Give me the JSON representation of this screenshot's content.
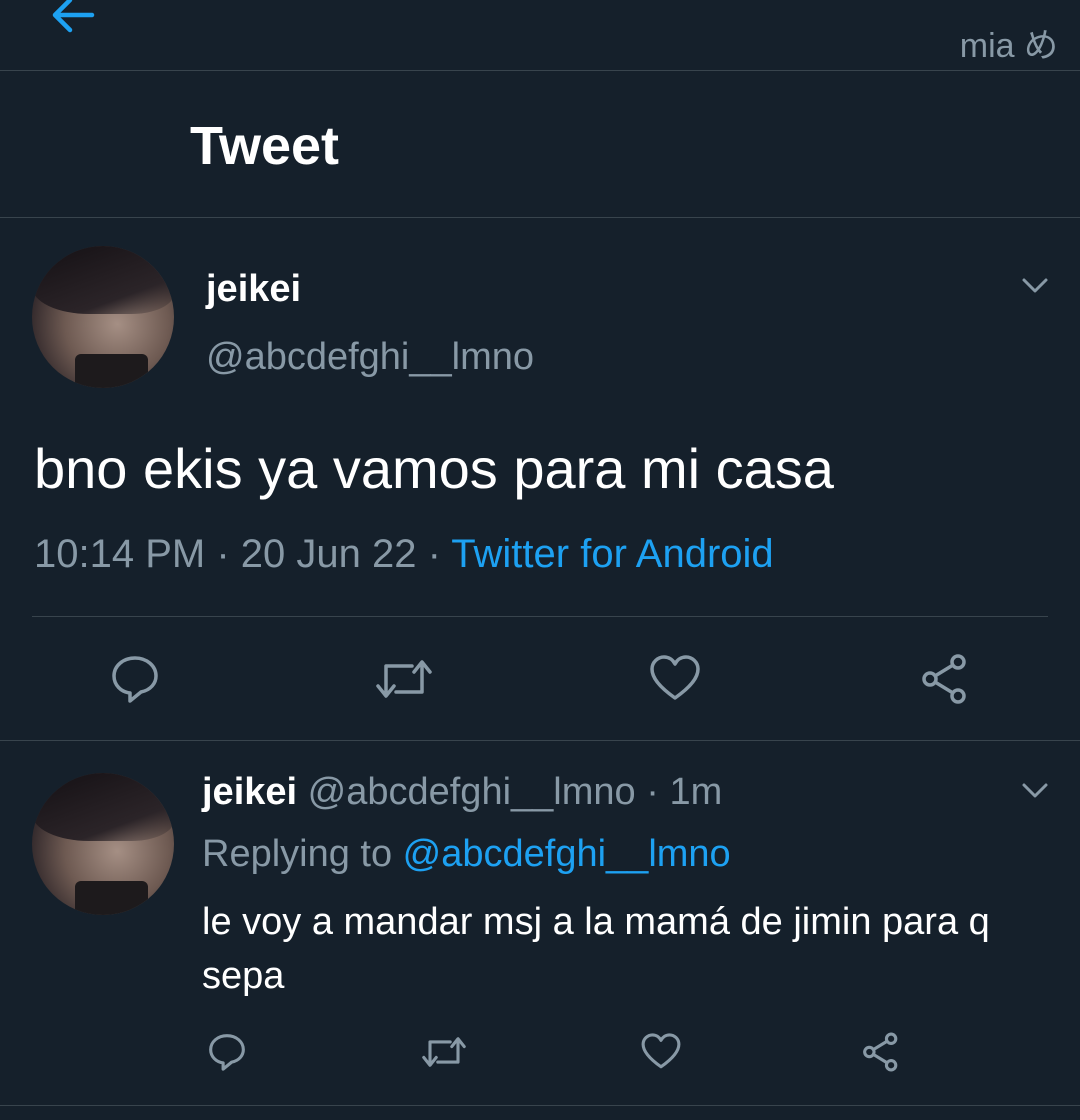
{
  "statusbar": {
    "tag": "mia め"
  },
  "header": {
    "title": "Tweet",
    "back_icon": "arrow-left-icon"
  },
  "colors": {
    "background": "#15202b",
    "accent": "#1da1f2",
    "muted": "#8899a6",
    "divider": "#38444d"
  },
  "main_tweet": {
    "display_name": "jeikei",
    "handle": "@abcdefghi__lmno",
    "text": "bno ekis ya vamos para mi casa",
    "time": "10:14 PM",
    "separator": " · ",
    "date": "20 Jun 22",
    "source": "Twitter for Android",
    "actions": [
      "reply-icon",
      "retweet-icon",
      "like-icon",
      "share-icon"
    ]
  },
  "reply_tweet": {
    "display_name": "jeikei",
    "handle": "@abcdefghi__lmno",
    "age": "1m",
    "separator": " · ",
    "replying_label": "Replying to ",
    "replying_to": "@abcdefghi__lmno",
    "text": "le voy a mandar msj a la mamá de jimin para q sepa",
    "actions": [
      "reply-icon",
      "retweet-icon",
      "like-icon",
      "share-icon"
    ]
  }
}
